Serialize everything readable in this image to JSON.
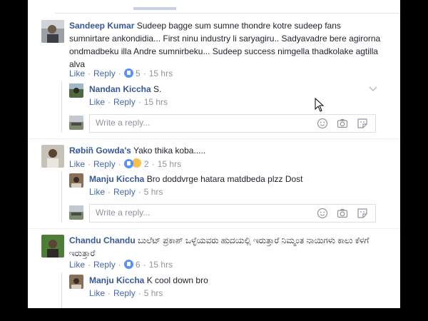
{
  "comments": [
    {
      "author": "Sandeep Kumar",
      "text": "Sudeep bagge sum sumne thondre kotre sudeep fans sumnirtare ankondidia... First ninu industry li saryagiru.. Sadyavadre bere agirorna ondmadbeku illa Andre sumnirbeku... Sudeep success nimgella thadkolake agtilla alva",
      "like_label": "Like",
      "reply_label": "Reply",
      "reaction_count": "5",
      "time": "15 hrs",
      "replies": [
        {
          "author": "Nandan Kiccha",
          "text": "S.",
          "like_label": "Like",
          "reply_label": "Reply",
          "time": "15 hrs"
        }
      ]
    },
    {
      "author": "Røbiñ Gowda's",
      "text": "Yako thika koba.....",
      "like_label": "Like",
      "reply_label": "Reply",
      "reaction_count": "2",
      "time": "15 hrs",
      "replies": [
        {
          "author": "Manju Kiccha",
          "text": "Bro doddvrge hatara matdbeda plzz Dost",
          "like_label": "Like",
          "reply_label": "Reply",
          "time": "5 hrs"
        }
      ]
    },
    {
      "author": "Chandu Chandu",
      "text": "ಬುಲೆಟ್ ಪ್ರಕಾಶ್ ಒಳ್ಳೆಯವರು ಹುದಯಲ್ಲಿ ಇರುತ್ತಾರೆ ನಿಮ್ಮಂತ ನಾಯಿಗಳು ಕಾಲು ಕೆಳಗೆ ಇರುತ್ತಾರೆ",
      "like_label": "Like",
      "reply_label": "Reply",
      "reaction_count": "6",
      "time": "15 hrs",
      "replies": [
        {
          "author": "Manju Kiccha",
          "text": "K cool down bro",
          "like_label": "Like",
          "reply_label": "Reply",
          "time": "5 hrs"
        }
      ]
    }
  ],
  "reply_box": {
    "placeholder": "Write a reply..."
  },
  "colors": {
    "link": "#4267b2",
    "name": "#365899",
    "meta": "#90949c",
    "like_icon": "#5890ff"
  }
}
